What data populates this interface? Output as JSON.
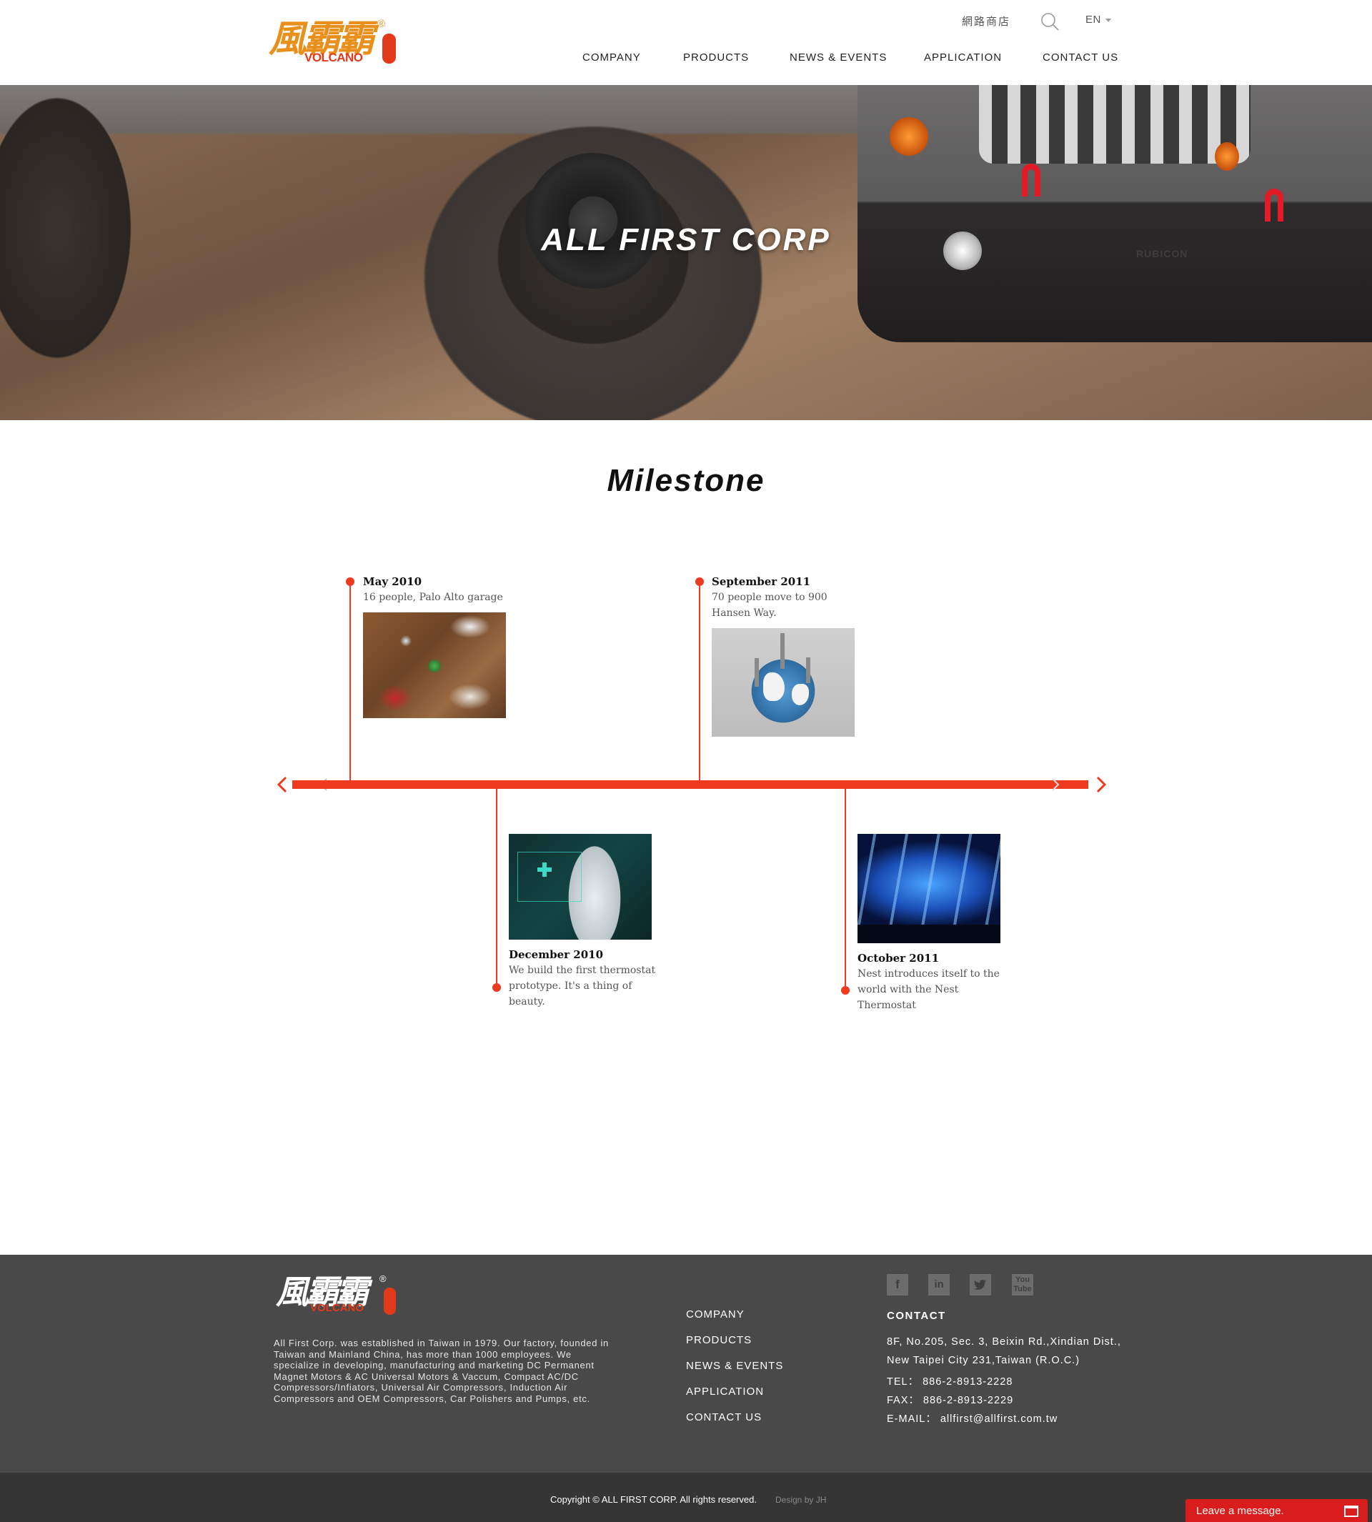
{
  "header": {
    "logo": {
      "cn": "風霸霸",
      "en": "VOLCANO",
      "registered": "®"
    },
    "shop_link": "網路商店",
    "language": "EN",
    "nav": [
      "COMPANY",
      "PRODUCTS",
      "NEWS & EVENTS",
      "APPLICATION",
      "CONTACT US"
    ]
  },
  "hero": {
    "title": "ALL FIRST CORP",
    "badge": "RUBICON"
  },
  "milestone": {
    "title": "Milestone",
    "events": [
      {
        "date": "May 2010",
        "desc": "16 people, Palo Alto garage"
      },
      {
        "date": "December 2010",
        "desc": "We build the first thermostat prototype. It's a thing of beauty."
      },
      {
        "date": "September 2011",
        "desc": "70 people move to 900 Hansen Way."
      },
      {
        "date": "October 2011",
        "desc": "Nest introduces itself to the world with the Nest Thermostat"
      }
    ]
  },
  "footer": {
    "about": "All First Corp. was established in Taiwan in 1979. Our factory, founded in Taiwan and Mainland China, has more than 1000 employees. We specialize in developing, manufacturing and marketing DC Permanent Magnet Motors & AC Universal Motors & Vaccum, Compact AC/DC Compressors/Infiators, Universal Air Compressors, Induction Air Compressors and OEM Compressors, Car Polishers and Pumps, etc.",
    "nav": [
      "COMPANY",
      "PRODUCTS",
      "NEWS & EVENTS",
      "APPLICATION",
      "CONTACT US"
    ],
    "social": [
      "facebook-icon",
      "linkedin-icon",
      "twitter-icon",
      "youtube-icon"
    ],
    "contact_title": "CONTACT",
    "address_line1": "8F, No.205, Sec. 3, Beixin Rd.,Xindian Dist.,",
    "address_line2": "New Taipei City 231,Taiwan (R.O.C.)",
    "tel": "TEL： 886-2-8913-2228",
    "fax": "FAX： 886-2-8913-2229",
    "email": "E-MAIL： allfirst@allfirst.com.tw"
  },
  "bottom": {
    "copyright": "Copyright © ALL FIRST CORP. All rights reserved.",
    "credit": "Design by JH",
    "leave_message": "Leave a message."
  },
  "colors": {
    "accent": "#ee3a1e",
    "footer_bg": "#494949",
    "bottom_bg": "#353535",
    "chat_bg": "#d91d1d"
  }
}
